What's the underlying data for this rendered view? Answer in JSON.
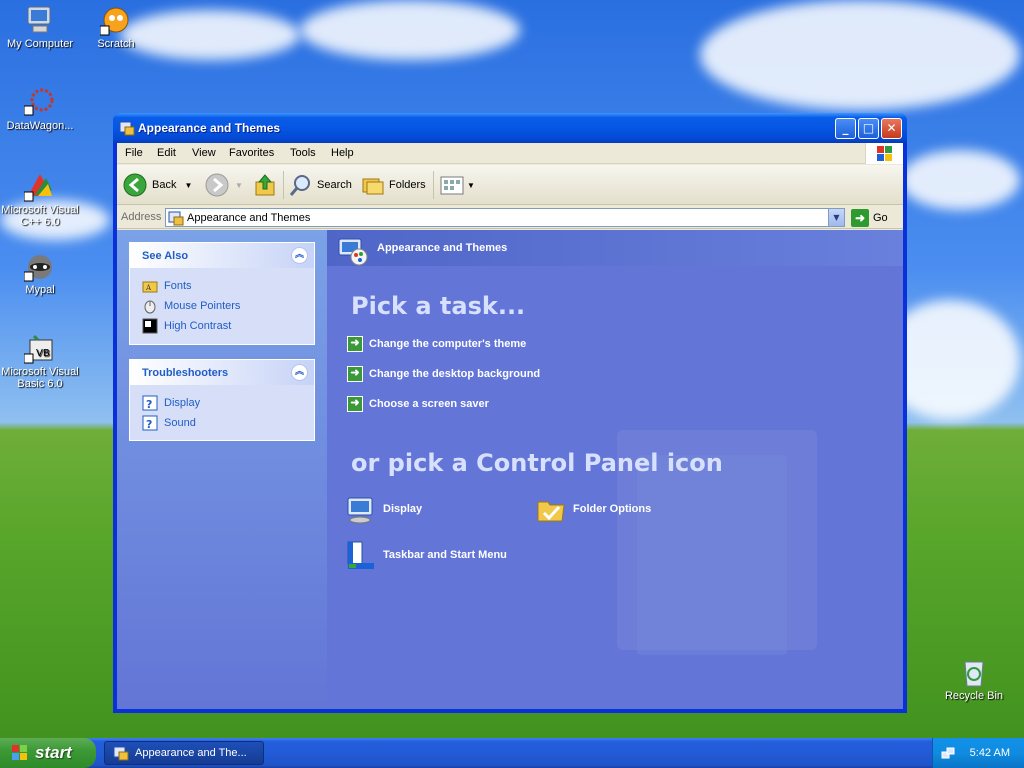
{
  "desktop": {
    "icons": [
      {
        "label": "My Computer"
      },
      {
        "label": "Scratch"
      },
      {
        "label": "DataWagon..."
      },
      {
        "label": "Microsoft Visual C++ 6.0"
      },
      {
        "label": "Mypal"
      },
      {
        "label": "Microsoft Visual Basic 6.0"
      },
      {
        "label": "Recycle Bin"
      }
    ]
  },
  "window": {
    "title": "Appearance and Themes",
    "menu": [
      "File",
      "Edit",
      "View",
      "Favorites",
      "Tools",
      "Help"
    ],
    "toolbar": {
      "back": "Back",
      "search": "Search",
      "folders": "Folders"
    },
    "address": {
      "label": "Address",
      "value": "Appearance and Themes",
      "go": "Go"
    },
    "see_also": {
      "title": "See Also",
      "items": [
        "Fonts",
        "Mouse Pointers",
        "High Contrast"
      ]
    },
    "troubleshooters": {
      "title": "Troubleshooters",
      "items": [
        "Display",
        "Sound"
      ]
    },
    "main": {
      "header": "Appearance and Themes",
      "pick_task": "Pick a task...",
      "tasks": [
        "Change the computer's theme",
        "Change the desktop background",
        "Choose a screen saver"
      ],
      "pick_icon": "or pick a Control Panel icon",
      "icons": [
        "Display",
        "Folder Options",
        "Taskbar and Start Menu"
      ]
    }
  },
  "taskbar": {
    "start": "start",
    "task": "Appearance and The...",
    "clock": "5:42 AM"
  }
}
